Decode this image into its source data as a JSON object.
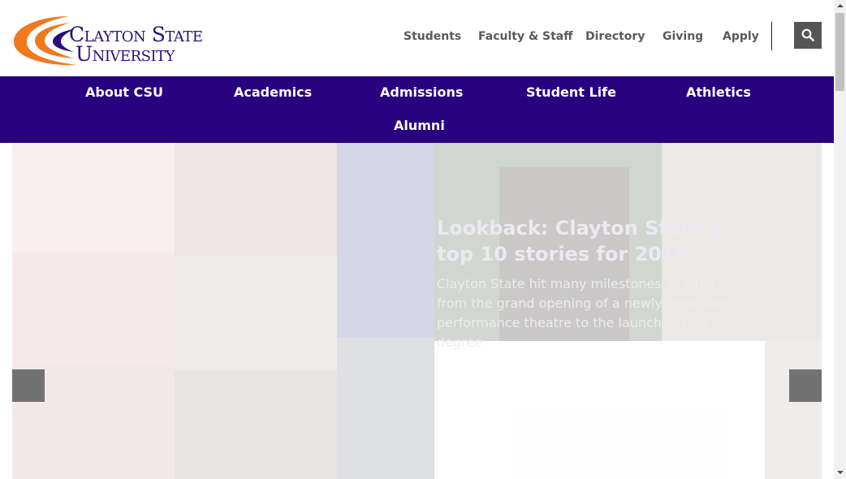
{
  "brand": {
    "logo_line1": "Clayton State",
    "logo_line2": "University",
    "logo_colors": {
      "navy": "#2a0f7a",
      "orange": "#f0781e"
    }
  },
  "utility_nav": {
    "items": [
      {
        "label": "Students"
      },
      {
        "label": "Faculty & Staff"
      },
      {
        "label": "Directory"
      },
      {
        "label": "Giving"
      },
      {
        "label": "Apply"
      }
    ],
    "search_icon": "search-icon"
  },
  "main_nav": {
    "background": "#28027e",
    "items": [
      {
        "label": "About CSU"
      },
      {
        "label": "Academics"
      },
      {
        "label": "Admissions"
      },
      {
        "label": "Student Life"
      },
      {
        "label": "Athletics"
      },
      {
        "label": "Alumni"
      }
    ]
  },
  "hero": {
    "headline": "Lookback: Clayton State's top 10 stories for 2019",
    "summary": "Clayton State hit many milestones in 2019–from the grand opening of a newly renovated performance theatre to the launch of new degree",
    "prev_icon": "chevron-left-icon",
    "next_icon": "chevron-right-icon"
  }
}
